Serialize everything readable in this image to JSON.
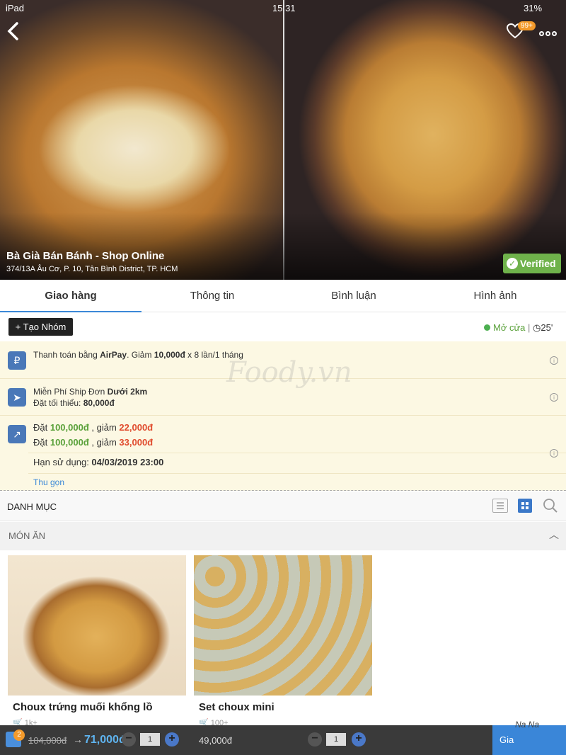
{
  "status_bar": {
    "carrier": "iPad",
    "time": "15:31",
    "battery": "31%"
  },
  "shop": {
    "name": "Bà Già Bán Bánh - Shop Online",
    "address": "374/13A Âu Cơ, P. 10, Tân Bình District, TP. HCM",
    "verified_label": "Verified",
    "favorites_badge": "99+"
  },
  "tabs": [
    {
      "label": "Giao hàng",
      "active": true
    },
    {
      "label": "Thông tin",
      "active": false
    },
    {
      "label": "Bình luận",
      "active": false
    },
    {
      "label": "Hình ảnh",
      "active": false
    }
  ],
  "group_button": "+ Tạo Nhóm",
  "open_status": {
    "label": "Mở cửa",
    "separator": "|",
    "time": "25'"
  },
  "promos": {
    "airpay": {
      "prefix": "Thanh toán bằng ",
      "brand": "AirPay",
      "mid": ". Giảm ",
      "amount": "10,000đ",
      "suffix": " x 8 lần/1 tháng"
    },
    "shipping": {
      "prefix": "Miễn Phí Ship Đơn ",
      "bold": "Dưới 2km",
      "min_label": "Đặt tối thiểu: ",
      "min_value": "80,000đ"
    },
    "discounts": [
      {
        "label": "Đặt ",
        "order": "100,000đ",
        "mid": " , giảm ",
        "off": "22,000đ"
      },
      {
        "label": "Đặt ",
        "order": "100,000đ",
        "mid": " , giảm ",
        "off": "33,000đ"
      }
    ],
    "expiry_label": "Hạn sử dụng: ",
    "expiry_value": "04/03/2019 23:00",
    "collapse_label": "Thu gọn"
  },
  "watermark": "Foody.vn",
  "category_header": "DANH MỤC",
  "section_title": "MÓN ĂN",
  "products": [
    {
      "title": "Choux trứng muối khổng lồ",
      "sold": "1k+"
    },
    {
      "title": "Set choux mini",
      "sold": "100+"
    }
  ],
  "bottom_bar": {
    "cart_count": "2",
    "old_price": "104,000đ",
    "arrow": "→",
    "new_price": "71,000đ",
    "qty1": "1",
    "price2": "49,000đ",
    "qty2": "1",
    "order_label": "Gia",
    "nana_label": "Na Na"
  },
  "colors": {
    "accent": "#3b88d7",
    "verified": "#6fb24b",
    "promo_bg": "#fcf8e3",
    "price_green": "#5aa13a",
    "price_red": "#e04b2d"
  }
}
